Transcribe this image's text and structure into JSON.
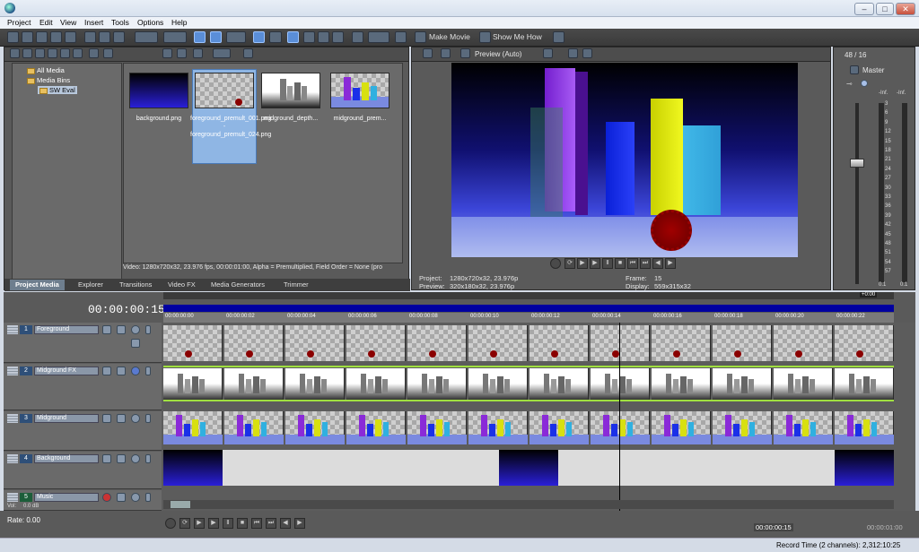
{
  "menu": [
    "Project",
    "Edit",
    "View",
    "Insert",
    "Tools",
    "Options",
    "Help"
  ],
  "toolbar": {
    "make_movie": "Make Movie",
    "show_me_how": "Show Me How"
  },
  "tree": {
    "all_media": "All Media",
    "media_bins": "Media Bins",
    "sw_eval": "SW Eval"
  },
  "media_files": [
    {
      "name": "background.png"
    },
    {
      "name": "foreground_premult_001.png - foreground_premult_024.png"
    },
    {
      "name": "midground_depth..."
    },
    {
      "name": "midground_prem..."
    }
  ],
  "media_info": "Video: 1280x720x32, 23.976 fps, 00:00:01:00, Alpha = Premultiplied, Field Order = None (pro",
  "tabs": [
    "Project Media",
    "Explorer",
    "Transitions",
    "Video FX",
    "Media Generators",
    "Trimmer"
  ],
  "preview": {
    "mode": "Preview (Auto)",
    "project_label": "Project:",
    "project_value": "1280x720x32, 23.976p",
    "preview_label": "Preview:",
    "preview_value": "320x180x32, 23.976p",
    "frame_label": "Frame:",
    "frame_value": "15",
    "display_label": "Display:",
    "display_value": "559x315x32"
  },
  "master": {
    "counter": "48 / 16",
    "label": "Master",
    "left_inf": "-Inf.",
    "right_inf": "-Inf.",
    "ticks": [
      "3",
      "6",
      "9",
      "12",
      "15",
      "18",
      "21",
      "24",
      "27",
      "30",
      "33",
      "36",
      "39",
      "42",
      "45",
      "48",
      "51",
      "54",
      "57"
    ],
    "bottom_left": "0.1",
    "bottom_right": "0.1"
  },
  "timeline": {
    "timecode": "00:00:00:15",
    "ruler": [
      "00:00:00:00",
      "00:00:00:02",
      "00:00:00:04",
      "00:00:00:06",
      "00:00:00:08",
      "00:00:00:10",
      "00:00:00:12",
      "00:00:00:14",
      "00:00:00:16",
      "00:00:00:18",
      "00:00:00:20",
      "00:00:00:22"
    ],
    "zoom_badge": "+0:00"
  },
  "tracks": [
    {
      "num": "1",
      "name": "Foreground"
    },
    {
      "num": "2",
      "name": "Midground FX"
    },
    {
      "num": "3",
      "name": "Midground"
    },
    {
      "num": "4",
      "name": "Background"
    },
    {
      "num": "5",
      "name": "Music"
    }
  ],
  "music": {
    "vol": "Vol:",
    "vol_value": "0.0 dB"
  },
  "rate": "Rate: 0.00",
  "bottom": {
    "timecode1": "00:00:00:15",
    "timecode2": "00:00:01:00"
  },
  "status": {
    "record_time": "Record Time (2 channels): 2,312:10:25"
  }
}
